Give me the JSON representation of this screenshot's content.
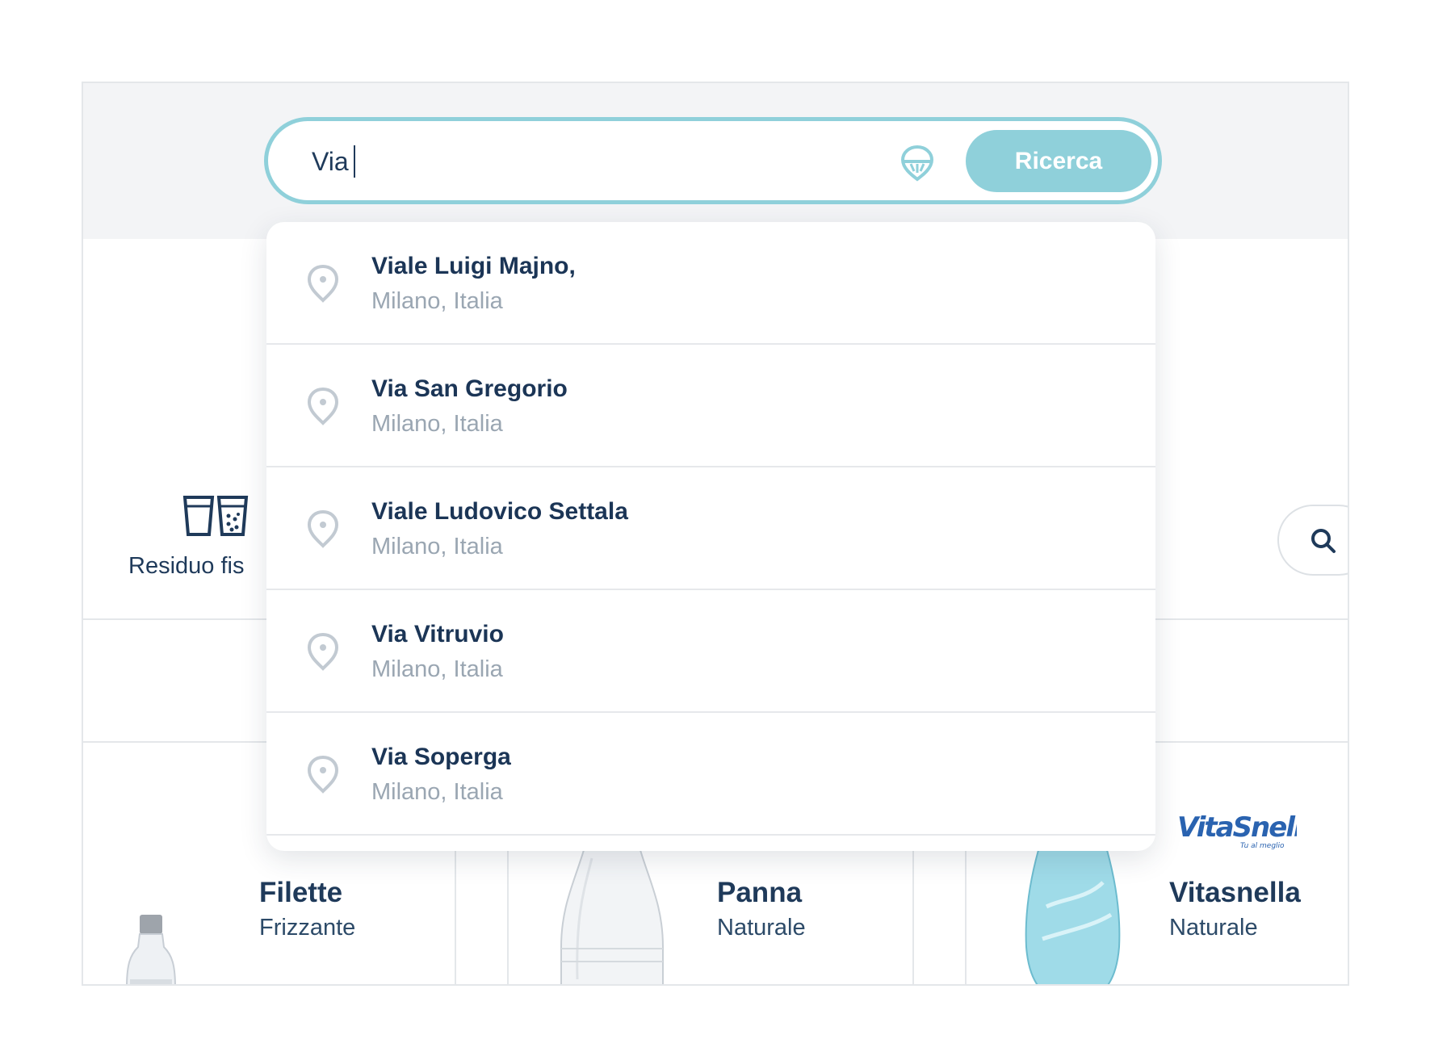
{
  "search": {
    "value": "Via",
    "button_label": "Ricerca",
    "geo_icon": "location-crosshair-icon"
  },
  "suggestions": [
    {
      "main": "Viale Luigi Majno,",
      "sub": "Milano, Italia",
      "icon": "map-pin-icon"
    },
    {
      "main": "Via San Gregorio",
      "sub": "Milano, Italia",
      "icon": "map-pin-icon"
    },
    {
      "main": "Viale Ludovico Settala",
      "sub": "Milano, Italia",
      "icon": "map-pin-icon"
    },
    {
      "main": "Via Vitruvio",
      "sub": "Milano, Italia",
      "icon": "map-pin-icon"
    },
    {
      "main": "Via Soperga",
      "sub": "Milano, Italia",
      "icon": "map-pin-icon"
    }
  ],
  "filters": {
    "residuo_label": "Residuo fis",
    "residuo_icon": "water-glasses-icon",
    "search_icon": "search-icon"
  },
  "products": [
    {
      "name": "Filette",
      "type": "Frizzante"
    },
    {
      "name": "Panna",
      "type": "Naturale"
    },
    {
      "name": "Vitasnella",
      "type": "Naturale"
    }
  ],
  "brand_logo": {
    "name": "VitaSnella",
    "tagline": "Tu al meglio"
  },
  "colors": {
    "accent": "#8fd0da",
    "primary_text": "#1b3556",
    "secondary_text": "#9aa6b2",
    "header_bg": "#f3f4f6"
  }
}
